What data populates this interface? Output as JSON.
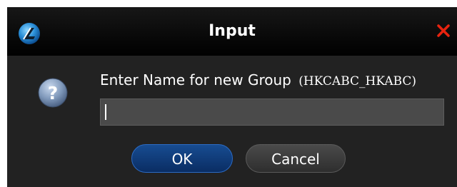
{
  "dialog": {
    "title": "Input",
    "app_icon": "app-logo-icon",
    "close_icon": "close-icon",
    "question_icon": "question-mark-icon",
    "prompt_label": "Enter Name for new Group",
    "prompt_group": "(HKCABC_HKABC)",
    "name_field": {
      "value": "",
      "placeholder": ""
    },
    "ok_label": "OK",
    "cancel_label": "Cancel"
  },
  "colors": {
    "title_bar": "#000000",
    "body_background": "#222222",
    "input_background": "#4a4a4a",
    "ok_button": "#174c91",
    "cancel_button": "#3c3c3c",
    "close_x": "#e8230f"
  }
}
